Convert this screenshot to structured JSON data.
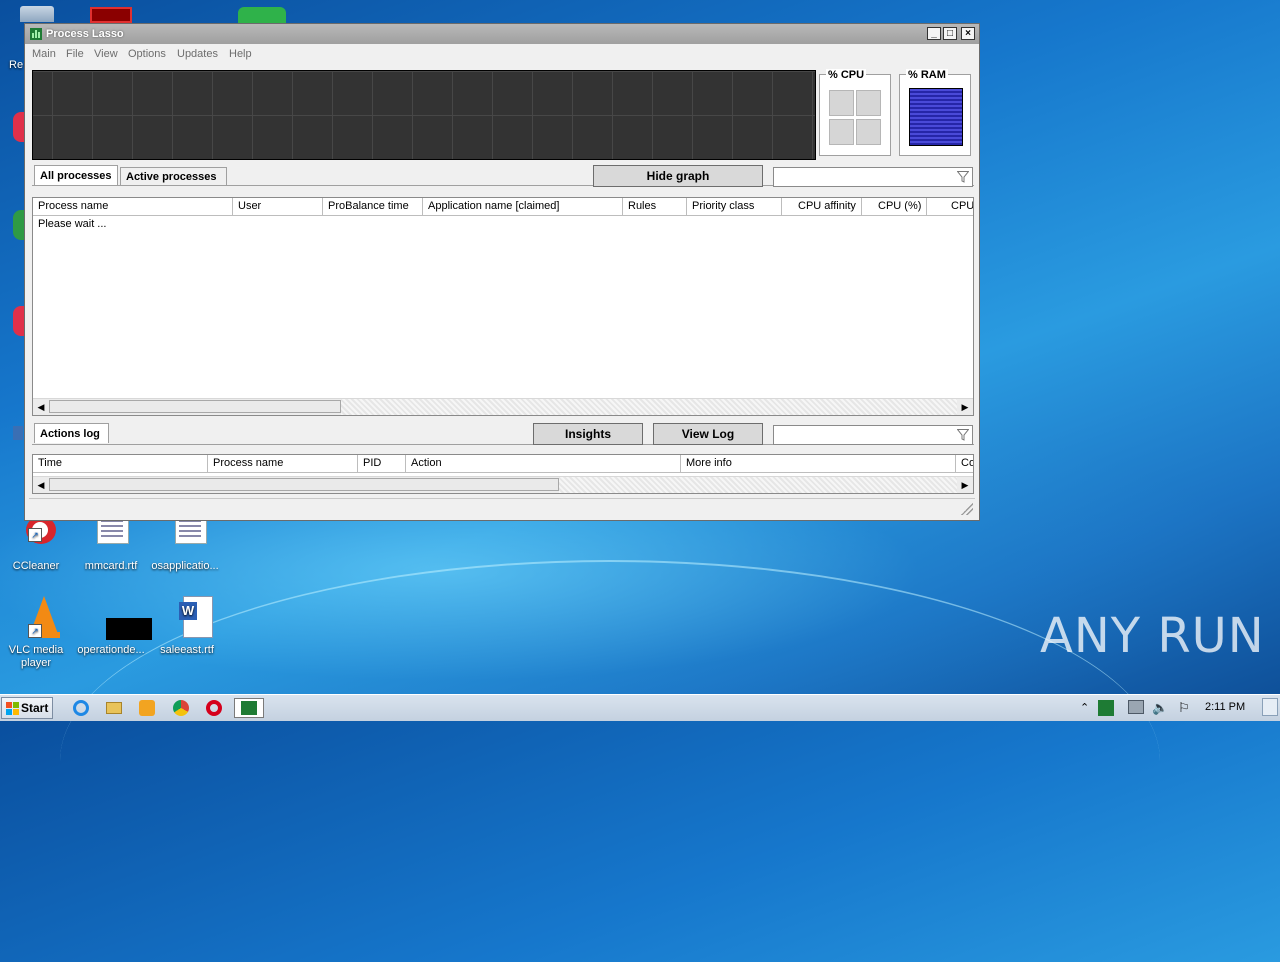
{
  "window": {
    "title": "Process Lasso",
    "min_glyph": "_",
    "max_glyph": "□",
    "close_glyph": "×"
  },
  "menu": [
    "Main",
    "File",
    "View",
    "Options",
    "Updates",
    "Help"
  ],
  "meters": {
    "cpu_label": "% CPU",
    "ram_label": "% RAM"
  },
  "process_tabs": {
    "all": "All processes",
    "active": "Active processes"
  },
  "hide_graph_label": "Hide graph",
  "process_columns": [
    "Process name",
    "User",
    "ProBalance time",
    "Application name [claimed]",
    "Rules",
    "Priority class",
    "CPU affinity",
    "CPU (%)",
    "CPU"
  ],
  "process_list_status": "Please wait ...",
  "actions_tab": "Actions log",
  "insights_label": "Insights",
  "view_log_label": "View Log",
  "log_columns": [
    "Time",
    "Process name",
    "PID",
    "Action",
    "More info",
    "Co"
  ],
  "desktop_icons": [
    {
      "label": "CCleaner"
    },
    {
      "label": "mmcard.rtf"
    },
    {
      "label": "osapplicatio..."
    },
    {
      "label": "VLC media player"
    },
    {
      "label": "operationde..."
    },
    {
      "label": "saleeast.rtf"
    }
  ],
  "desktop_partial": {
    "top_left": "Re"
  },
  "taskbar": {
    "start_label": "Start",
    "clock": "2:11 PM"
  },
  "watermark": "ANY RUN",
  "colors": {
    "accent_green": "#1e7b34",
    "ram_fill": "#3a3ac8",
    "graph_bg": "#333333"
  }
}
